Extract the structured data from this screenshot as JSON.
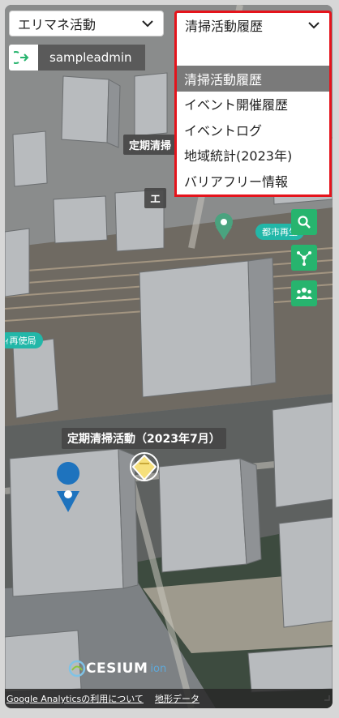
{
  "area_select": {
    "value": "エリマネ活動"
  },
  "history_select": {
    "value": "清掃活動履歴",
    "options": [
      "清掃活動履歴",
      "イベント開催履歴",
      "イベントログ",
      "地域統計(2023年)",
      "バリアフリー情報"
    ],
    "selected_index": 0
  },
  "user": {
    "name": "sampleadmin",
    "icon": "logout-icon"
  },
  "tools": [
    {
      "name": "search-icon"
    },
    {
      "name": "network-icon"
    },
    {
      "name": "people-icon"
    }
  ],
  "map_labels": {
    "main": "定期清掃活動（2023年7月）",
    "top_partial": "定期清掃",
    "mid_partial": "エ",
    "teal1": "都市再生",
    "teal2": "ｨ再使局"
  },
  "footer": {
    "analytics_link": "Google Analyticsの利用について",
    "terrain_link": "地形データ"
  },
  "branding": {
    "cesium": "CESIUM",
    "ion": "ion"
  },
  "colors": {
    "accent": "#27b46e",
    "highlight": "#e5141c",
    "selected_bg": "#7a7a7a"
  }
}
